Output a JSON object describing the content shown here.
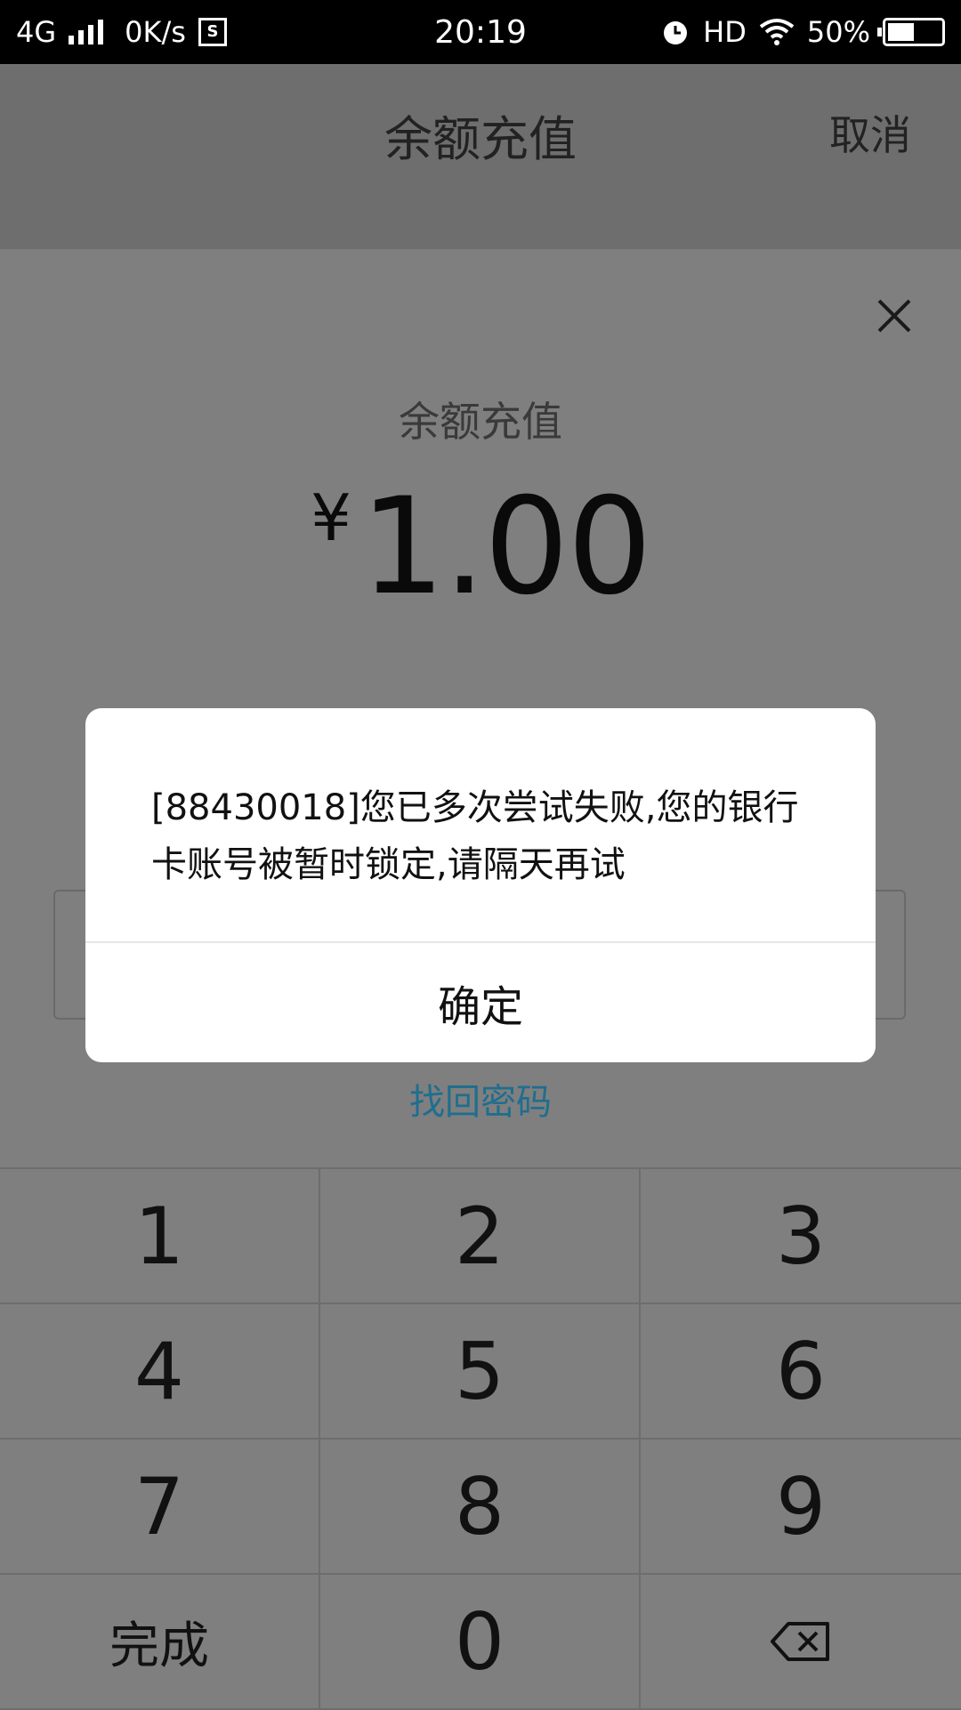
{
  "status_bar": {
    "network": "4G",
    "speed": "0K/s",
    "sim_icon_letter": "S",
    "time": "20:19",
    "hd": "HD",
    "battery": "50%",
    "battery_level": 0.5
  },
  "header": {
    "title": "余额充值",
    "cancel": "取消"
  },
  "sheet": {
    "title": "余额充值",
    "currency": "¥",
    "amount": "1.00",
    "forgot_password": "找回密码"
  },
  "dialog": {
    "message": "[88430018]您已多次尝试失败,您的银行卡账号被暂时锁定,请隔天再试",
    "ok": "确定"
  },
  "keypad": {
    "keys": [
      "1",
      "2",
      "3",
      "4",
      "5",
      "6",
      "7",
      "8",
      "9",
      "完成",
      "0"
    ],
    "delete_icon": "backspace-icon"
  },
  "colors": {
    "overlay": "#7f7f7f",
    "link": "#1f6e8f",
    "dialog_bg": "#ffffff"
  }
}
